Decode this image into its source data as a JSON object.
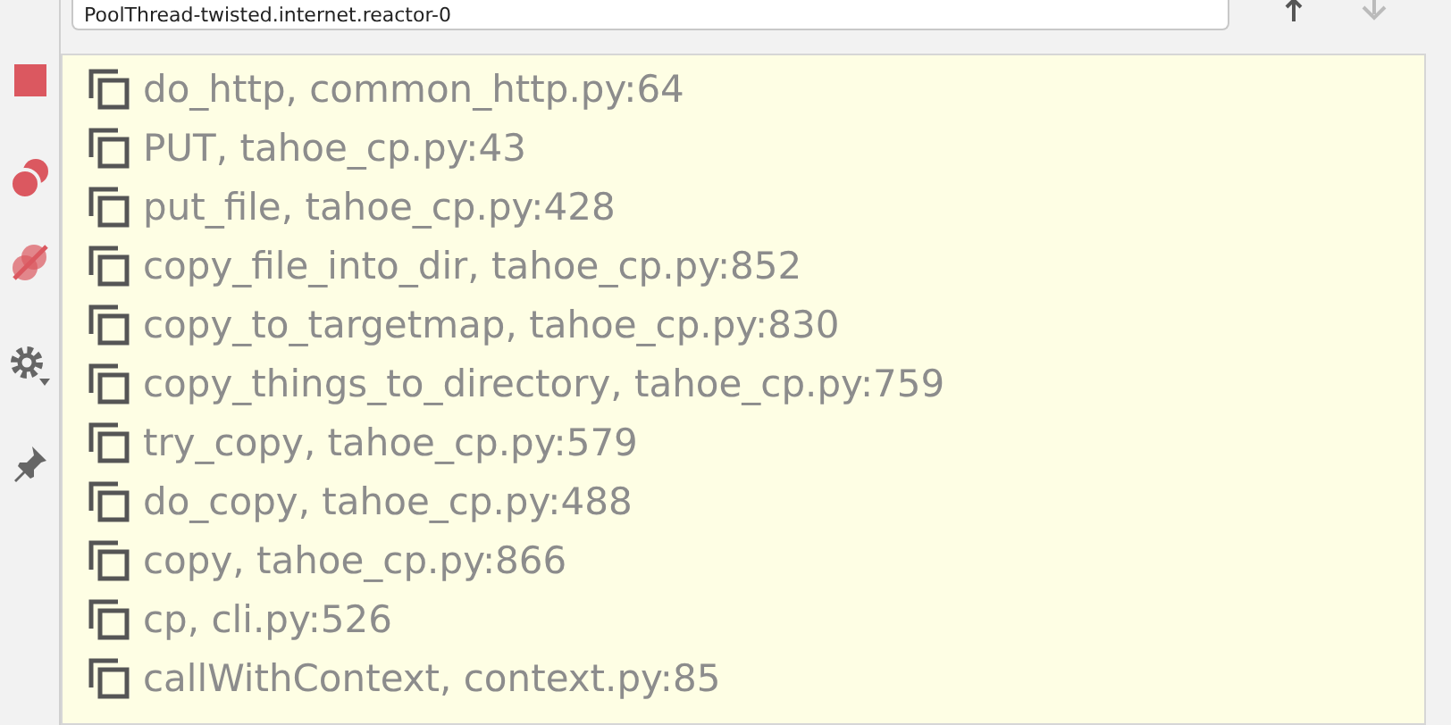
{
  "thread_selector": {
    "value": "PoolThread-twisted.internet.reactor-0"
  },
  "frames": [
    {
      "label": "do_http, common_http.py:64"
    },
    {
      "label": "PUT, tahoe_cp.py:43"
    },
    {
      "label": "put_file, tahoe_cp.py:428"
    },
    {
      "label": "copy_file_into_dir, tahoe_cp.py:852"
    },
    {
      "label": "copy_to_targetmap, tahoe_cp.py:830"
    },
    {
      "label": "copy_things_to_directory, tahoe_cp.py:759"
    },
    {
      "label": "try_copy, tahoe_cp.py:579"
    },
    {
      "label": "do_copy, tahoe_cp.py:488"
    },
    {
      "label": "copy, tahoe_cp.py:866"
    },
    {
      "label": "cp, cli.py:526"
    },
    {
      "label": "callWithContext, context.py:85"
    }
  ]
}
